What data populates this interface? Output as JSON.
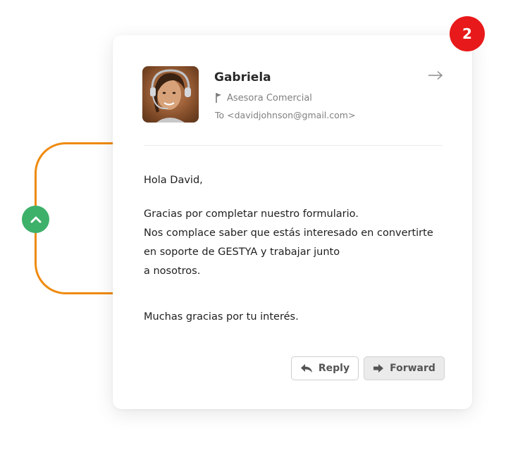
{
  "notification": {
    "count": "2"
  },
  "email": {
    "sender_name": "Gabriela",
    "sender_role": "Asesora Comercial",
    "recipient": "To <davidjohnson@gmail.com>",
    "greeting": "Hola David,",
    "body_lines": [
      "Gracias por completar nuestro formulario.",
      "Nos complace saber que estás interesado en convertirte",
      "en soporte de GESTYA y trabajar junto",
      "a nosotros."
    ],
    "closing": "Muchas gracias por tu interés."
  },
  "actions": {
    "reply_label": "Reply",
    "forward_label": "Forward"
  },
  "colors": {
    "connector": "#ef8a0e",
    "collapse_button": "#3db06a",
    "badge": "#e8191a"
  },
  "icons": [
    "chevron-up-icon",
    "arrow-right-icon",
    "flag-icon",
    "reply-icon",
    "forward-icon"
  ]
}
